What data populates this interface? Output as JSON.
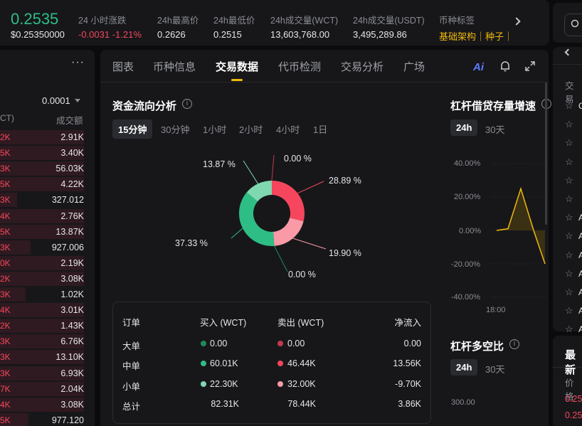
{
  "ticker": {
    "price": "0.2535",
    "price_usd": "$0.25350000",
    "stats": [
      {
        "label": "24 小时涨跌",
        "value": "-0.0031 -1.21%"
      },
      {
        "label": "24h最高价",
        "value": "0.2626"
      },
      {
        "label": "24h最低价",
        "value": "0.2515"
      },
      {
        "label": "24h成交量(WCT)",
        "value": "13,603,768.00"
      },
      {
        "label": "24h成交量(USDT)",
        "value": "3,495,289.86"
      },
      {
        "label": "币种标签",
        "value": "基础架构｜种子｜L"
      }
    ],
    "colors": {
      "up": "#2ebd85",
      "down": "#f6465d",
      "tag": "#f0b90b"
    }
  },
  "order_book": {
    "more_icon": "more-dots-icon",
    "step": "0.0001",
    "header_price": "CT)",
    "header_amount": "成交额",
    "rows": [
      {
        "price": "2K",
        "amount": "2.91K",
        "depth": 0.98
      },
      {
        "price": "5K",
        "amount": "3.40K",
        "depth": 0.98
      },
      {
        "price": "3K",
        "amount": "56.03K",
        "depth": 0.98
      },
      {
        "price": "5K",
        "amount": "4.22K",
        "depth": 0.98
      },
      {
        "price": "3K",
        "amount": "327.012",
        "depth": 0.2
      },
      {
        "price": "4K",
        "amount": "2.76K",
        "depth": 0.98
      },
      {
        "price": "5K",
        "amount": "13.87K",
        "depth": 0.98
      },
      {
        "price": "3K",
        "amount": "927.006",
        "depth": 0.36
      },
      {
        "price": "0K",
        "amount": "2.19K",
        "depth": 0.98
      },
      {
        "price": "2K",
        "amount": "3.08K",
        "depth": 0.98
      },
      {
        "price": "3K",
        "amount": "1.02K",
        "depth": 0.3
      },
      {
        "price": "4K",
        "amount": "3.01K",
        "depth": 0.98
      },
      {
        "price": "2K",
        "amount": "1.43K",
        "depth": 0.98
      },
      {
        "price": "3K",
        "amount": "6.76K",
        "depth": 0.98
      },
      {
        "price": "3K",
        "amount": "13.10K",
        "depth": 0.98
      },
      {
        "price": "3K",
        "amount": "6.93K",
        "depth": 0.98
      },
      {
        "price": "7K",
        "amount": "2.04K",
        "depth": 0.98
      },
      {
        "price": "4K",
        "amount": "3.08K",
        "depth": 0.98
      },
      {
        "price": "5K",
        "amount": "977.120",
        "depth": 0.33
      }
    ]
  },
  "tabs": [
    "图表",
    "币种信息",
    "交易数据",
    "代币检测",
    "交易分析",
    "广场"
  ],
  "tab_active": "交易数据",
  "toolbar": {
    "ai_label": "Ai",
    "bell_icon": "bell-icon",
    "expand_icon": "expand-icon"
  },
  "fund_flow": {
    "title": "资金流向分析",
    "info_icon": "info-icon",
    "intervals": [
      "15分钟",
      "30分钟",
      "1小时",
      "2小时",
      "4小时",
      "1日"
    ],
    "active_interval": "15分钟",
    "donut_labels": [
      "13.87 %",
      "0.00 %",
      "28.89 %",
      "19.90 %",
      "0.00 %",
      "37.33 %"
    ],
    "table": {
      "headers": [
        "订单",
        "买入 (WCT)",
        "卖出 (WCT)",
        "净流入"
      ],
      "rows": [
        {
          "name": "大单",
          "buy": "0.00",
          "sell": "0.00",
          "net": "0.00"
        },
        {
          "name": "中单",
          "buy": "60.01K",
          "sell": "46.44K",
          "net": "13.56K"
        },
        {
          "name": "小单",
          "buy": "22.30K",
          "sell": "32.00K",
          "net": "-9.70K"
        },
        {
          "name": "总计",
          "buy": "82.31K",
          "sell": "78.44K",
          "net": "3.86K"
        }
      ]
    },
    "colors": {
      "buy_large": "#1e8a5c",
      "buy_medium": "#2ebd85",
      "buy_small": "#7fd8b0",
      "sell_large": "#c23a4e",
      "sell_medium": "#f6465d",
      "sell_small": "#f99aa6"
    }
  },
  "chart_data": [
    {
      "type": "pie",
      "style": "donut",
      "categories": [
        "大单买入",
        "中单买入",
        "小单买入",
        "大单卖出",
        "中单卖出",
        "小单卖出"
      ],
      "values": [
        0.0,
        37.33,
        13.87,
        0.0,
        28.89,
        19.9
      ],
      "value_labels": [
        "0.00 %",
        "37.33 %",
        "13.87 %",
        "0.00 %",
        "28.89 %",
        "19.90 %"
      ]
    },
    {
      "type": "area",
      "title": "杠杆借贷存量增速",
      "intervals": [
        "24h",
        "30天"
      ],
      "active_interval": "24h",
      "y_ticks": [
        "40.00%",
        "20.00%",
        "0.00%",
        "-20.00%",
        "-40.00%"
      ],
      "x_ticks": [
        "18:00"
      ],
      "ylim": [
        -40,
        40
      ],
      "series": [
        {
          "values": [
            0,
            1,
            25,
            0,
            -20
          ]
        }
      ],
      "grid": true
    },
    {
      "type": "line",
      "title": "杠杆多空比",
      "intervals": [
        "24h",
        "30天"
      ],
      "active_interval": "24h",
      "y_ticks": [
        "300.00"
      ]
    }
  ],
  "leverage_growth": {
    "title": "杠杆借贷存量增速",
    "intervals": [
      "24h",
      "30天"
    ],
    "active": "24h",
    "info_icon": "info-icon"
  },
  "long_short": {
    "title": "杠杆多空比",
    "intervals": [
      "24h",
      "30天"
    ],
    "active": "24h",
    "info_icon": "info-icon"
  },
  "right_panel": {
    "back_icon": "chevron-left-icon",
    "header": "交易",
    "star_icon": "star-icon",
    "list_letters": [
      "C",
      "〔",
      "〔",
      "〔",
      "〔",
      "〔",
      "A",
      "A",
      "A",
      "A",
      "A",
      "A",
      "A",
      "A"
    ],
    "bottom_title": "最新",
    "bottom_header": "价格",
    "bottom_prices": [
      "0.25",
      "0.25"
    ]
  }
}
